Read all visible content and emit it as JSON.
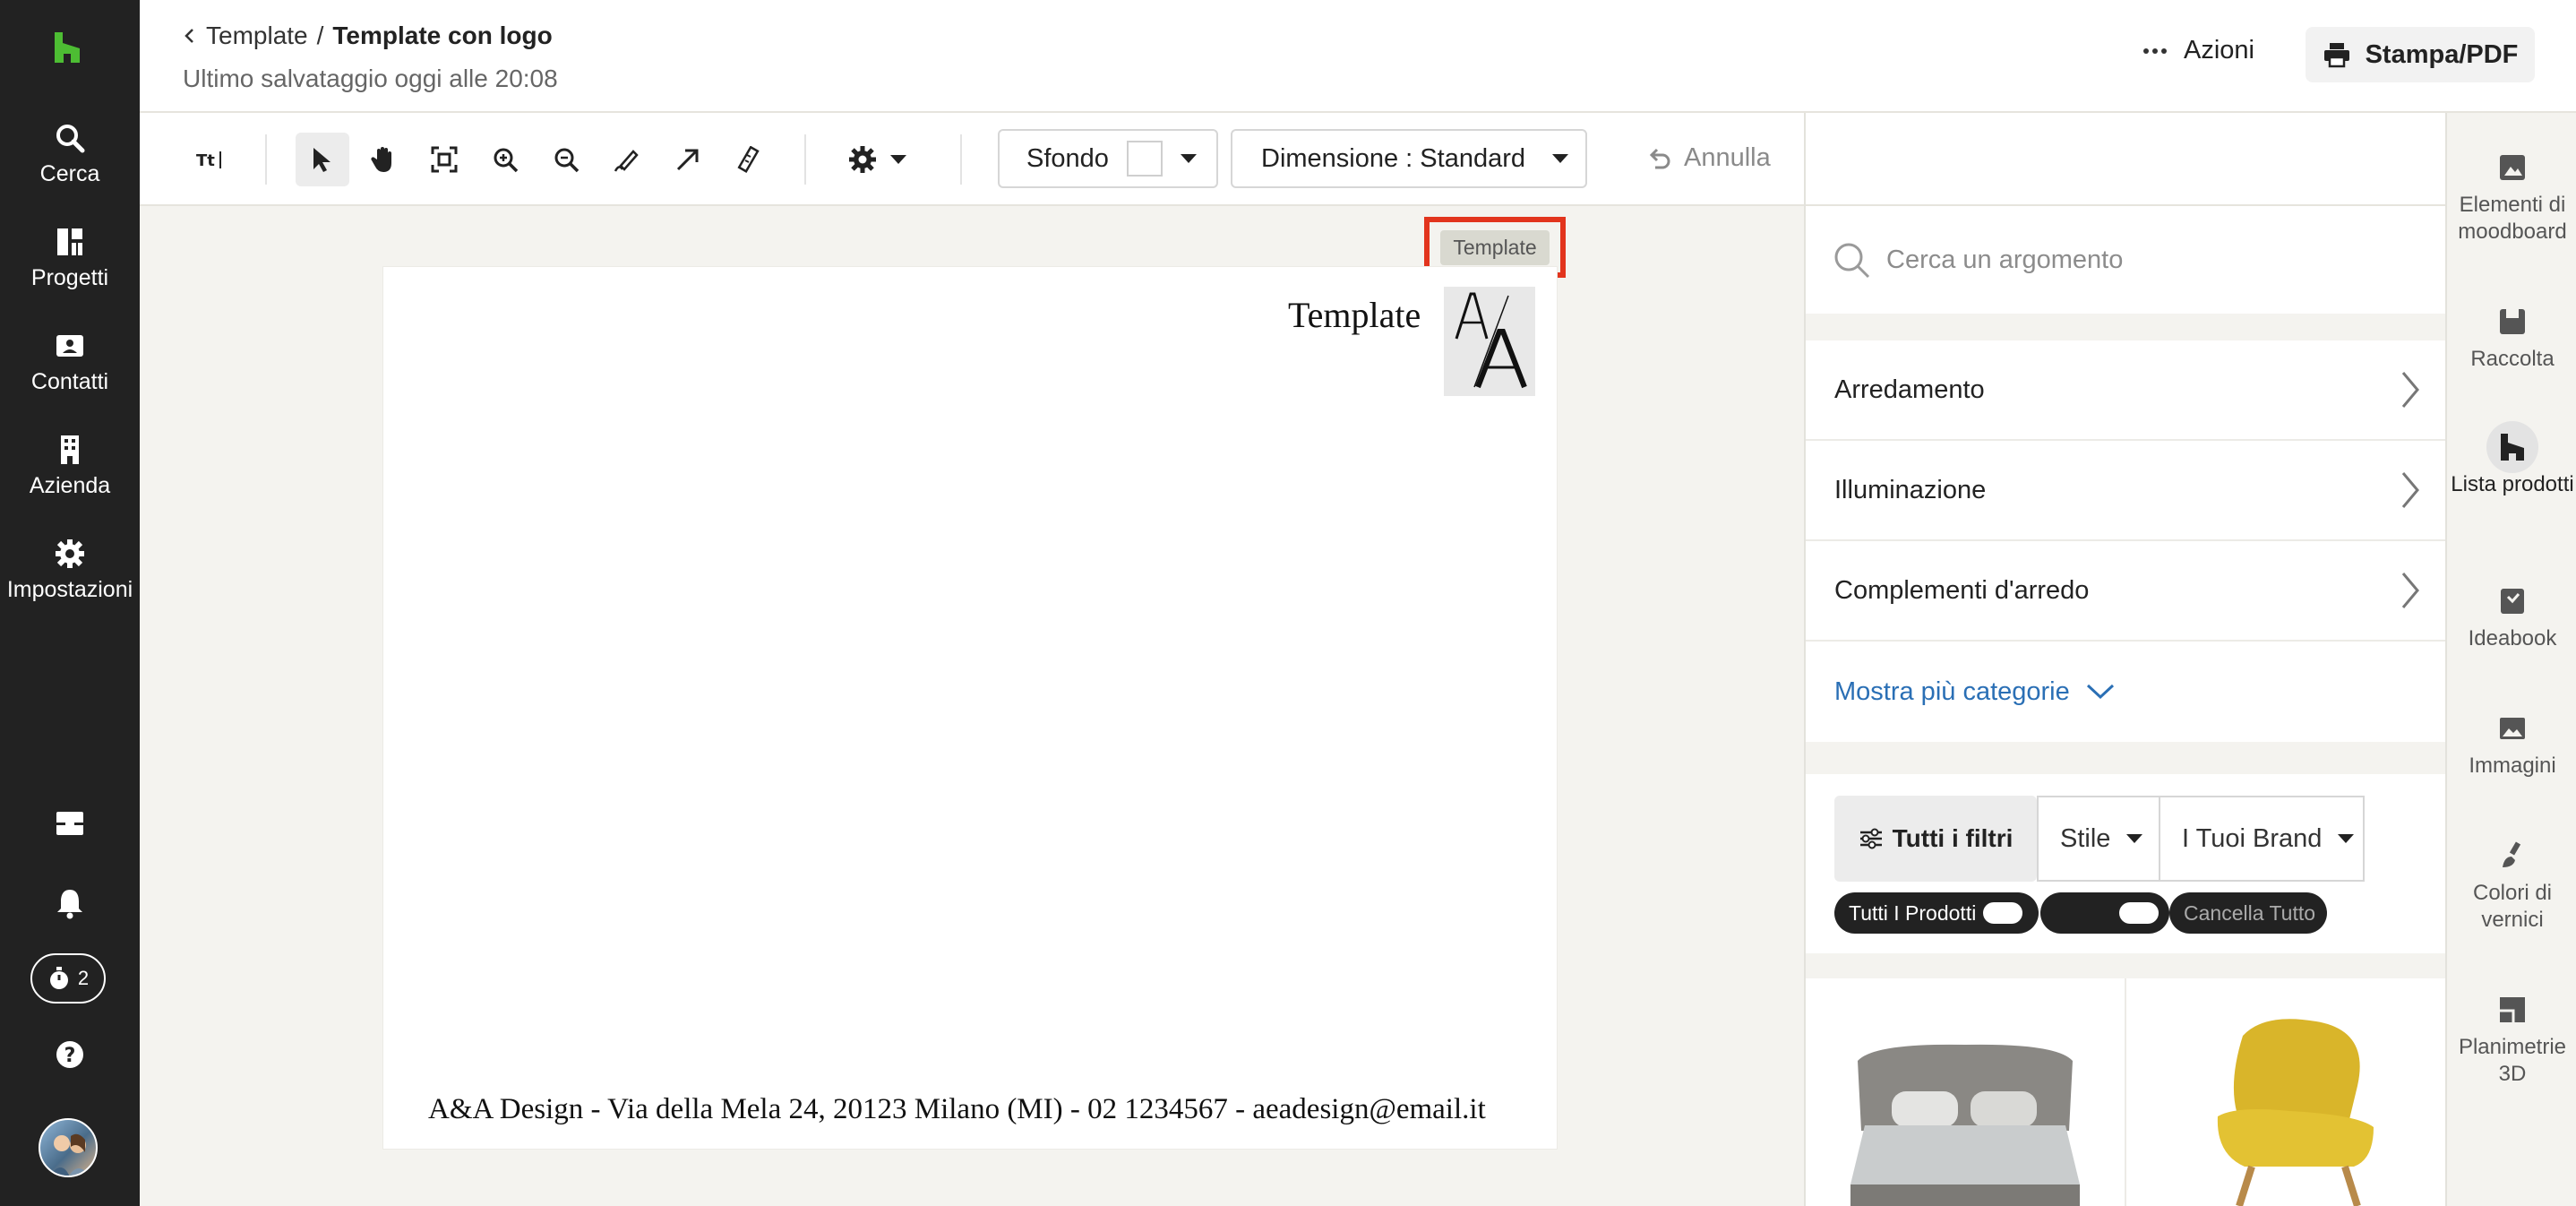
{
  "nav": {
    "items": [
      {
        "label": "Cerca",
        "icon": "search-icon"
      },
      {
        "label": "Progetti",
        "icon": "projects-icon"
      },
      {
        "label": "Contatti",
        "icon": "contacts-icon"
      },
      {
        "label": "Azienda",
        "icon": "company-icon"
      },
      {
        "label": "Impostazioni",
        "icon": "gear-icon"
      }
    ],
    "timer_count": "2",
    "accent": "#4dbd33"
  },
  "header": {
    "breadcrumb_parent": "Template",
    "breadcrumb_sep": "/",
    "breadcrumb_current": "Template con logo",
    "saved_text": "Ultimo salvataggio oggi alle 20:08",
    "actions_label": "Azioni",
    "print_label": "Stampa/PDF"
  },
  "toolbar": {
    "sfondo_label": "Sfondo",
    "dimensione_label": "Dimensione : Standard",
    "annulla_label": "Annulla"
  },
  "canvas": {
    "template_tag": "Template",
    "page_title": "Template",
    "footer_text": "A&A Design - Via della Mela 24, 20123 Milano (MI) - 02 1234567 - aeadesign@email.it",
    "highlight_color": "#e2341d"
  },
  "panel": {
    "search_placeholder": "Cerca un argomento",
    "categories": [
      "Arredamento",
      "Illuminazione",
      "Complementi d'arredo"
    ],
    "more_categories": "Mostra più categorie",
    "all_filters": "Tutti i filtri",
    "stile": "Stile",
    "brand": "I Tuoi Brand",
    "chip_all_products": "Tutti I Prodotti",
    "chip_clear": "Cancella Tutto"
  },
  "rbar": {
    "items": [
      "Elementi di moodboard",
      "Raccolta",
      "Lista prodotti",
      "Ideabook",
      "Immagini",
      "Colori di vernici",
      "Planimetrie 3D"
    ]
  }
}
